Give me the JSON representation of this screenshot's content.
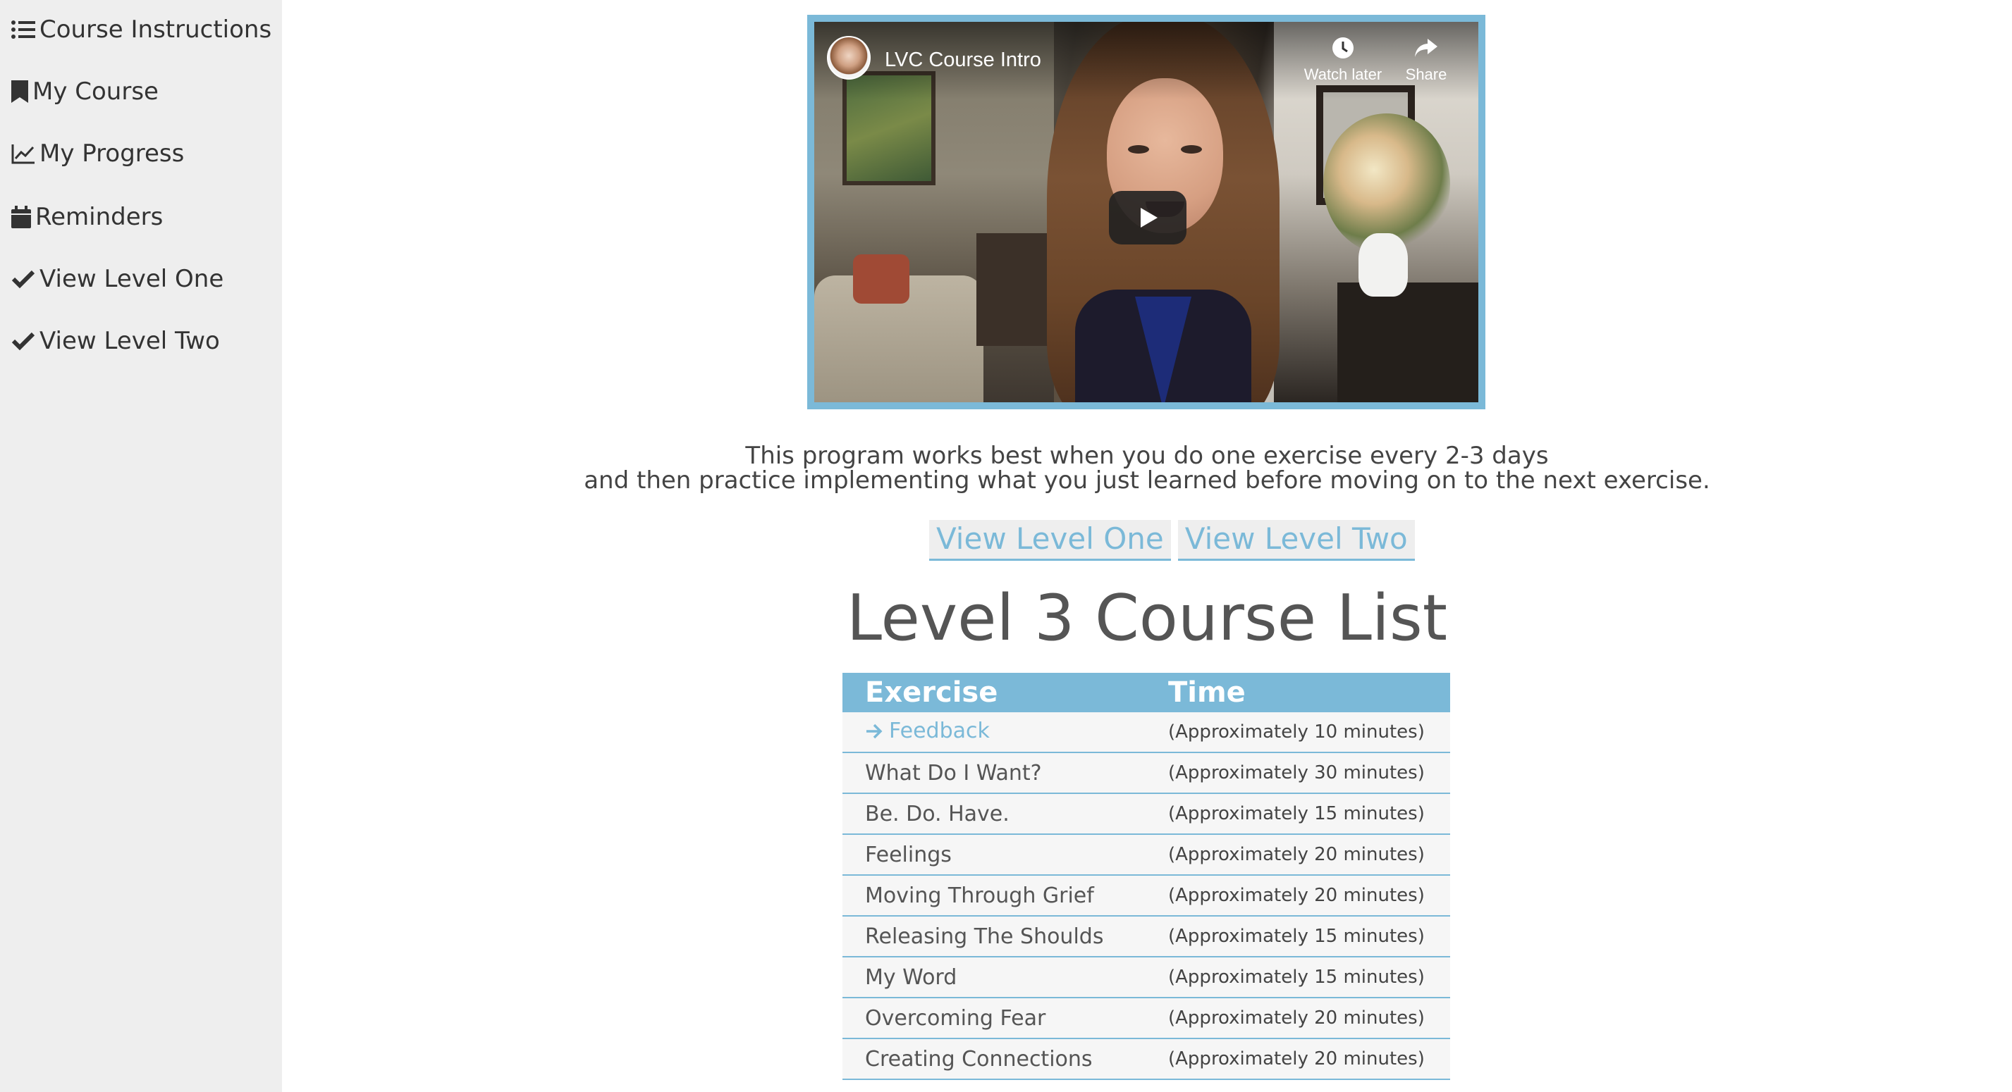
{
  "sidebar": {
    "items": [
      {
        "label": "Course Instructions",
        "icon": "list-icon"
      },
      {
        "label": "My Course",
        "icon": "bookmark-icon"
      },
      {
        "label": "My Progress",
        "icon": "line-chart-icon"
      },
      {
        "label": "Reminders",
        "icon": "calendar-icon"
      },
      {
        "label": "View Level One",
        "icon": "check-icon"
      },
      {
        "label": "View Level Two",
        "icon": "check-icon"
      }
    ]
  },
  "video": {
    "title": "LVC Course Intro",
    "watch_later": "Watch later",
    "share": "Share"
  },
  "intro": {
    "line1": "This program works best when you do one exercise every 2-3 days",
    "line2": "and then practice implementing what you just learned before moving on to the next exercise."
  },
  "level_links": {
    "one": "View Level One",
    "two": "View Level Two"
  },
  "course_list": {
    "title": "Level 3 Course List",
    "headers": {
      "exercise": "Exercise",
      "time": "Time"
    },
    "rows": [
      {
        "exercise": "Feedback",
        "time": "(Approximately 10 minutes)"
      },
      {
        "exercise": "What Do I Want?",
        "time": "(Approximately 30 minutes)"
      },
      {
        "exercise": "Be. Do. Have.",
        "time": "(Approximately 15 minutes)"
      },
      {
        "exercise": "Feelings",
        "time": "(Approximately 20 minutes)"
      },
      {
        "exercise": "Moving Through Grief",
        "time": "(Approximately 20 minutes)"
      },
      {
        "exercise": "Releasing The Shoulds",
        "time": "(Approximately 15 minutes)"
      },
      {
        "exercise": "My Word",
        "time": "(Approximately 15 minutes)"
      },
      {
        "exercise": "Overcoming Fear",
        "time": "(Approximately 20 minutes)"
      },
      {
        "exercise": "Creating Connections",
        "time": "(Approximately 20 minutes)"
      }
    ]
  },
  "colors": {
    "accent": "#7bb9d8",
    "sidebar_bg": "#eeeeee",
    "text": "#555555"
  }
}
